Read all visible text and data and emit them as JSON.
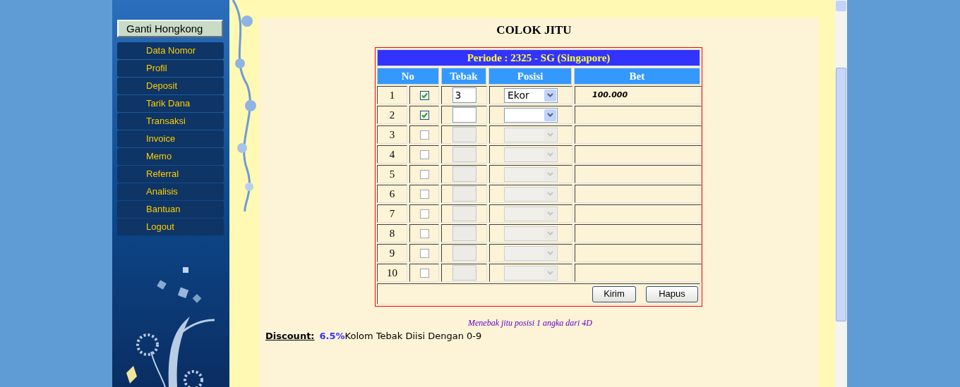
{
  "sidebar": {
    "switch_button": "Ganti Hongkong",
    "items": [
      "Data Nomor",
      "Profil",
      "Deposit",
      "Tarik Dana",
      "Transaksi",
      "Invoice",
      "Memo",
      "Referral",
      "Analisis",
      "Bantuan",
      "Logout"
    ]
  },
  "form": {
    "title": "COLOK JITU",
    "period": "Periode : 2325 - SG (Singapore)",
    "columns": [
      "No",
      "Tebak",
      "Posisi",
      "Bet"
    ],
    "rows": [
      {
        "no": "1",
        "checked": true,
        "disabled": false,
        "tebak": "3",
        "posisi": "Ekor",
        "bet": "100.000"
      },
      {
        "no": "2",
        "checked": true,
        "disabled": false
      },
      {
        "no": "3",
        "checked": false,
        "disabled": true
      },
      {
        "no": "4",
        "checked": false,
        "disabled": true
      },
      {
        "no": "5",
        "checked": false,
        "disabled": true
      },
      {
        "no": "6",
        "checked": false,
        "disabled": true
      },
      {
        "no": "7",
        "checked": false,
        "disabled": true
      },
      {
        "no": "8",
        "checked": false,
        "disabled": true
      },
      {
        "no": "9",
        "checked": false,
        "disabled": true
      },
      {
        "no": "10",
        "checked": false,
        "disabled": true
      }
    ],
    "buttons": [
      "Kirim",
      "Hapus"
    ]
  },
  "note": "Menebak jitu posisi 1 angka dari 4D",
  "discount": {
    "label": "Discount:",
    "value": "6.5%",
    "hint": "Kolom Tebak Diisi Dengan 0-9"
  }
}
